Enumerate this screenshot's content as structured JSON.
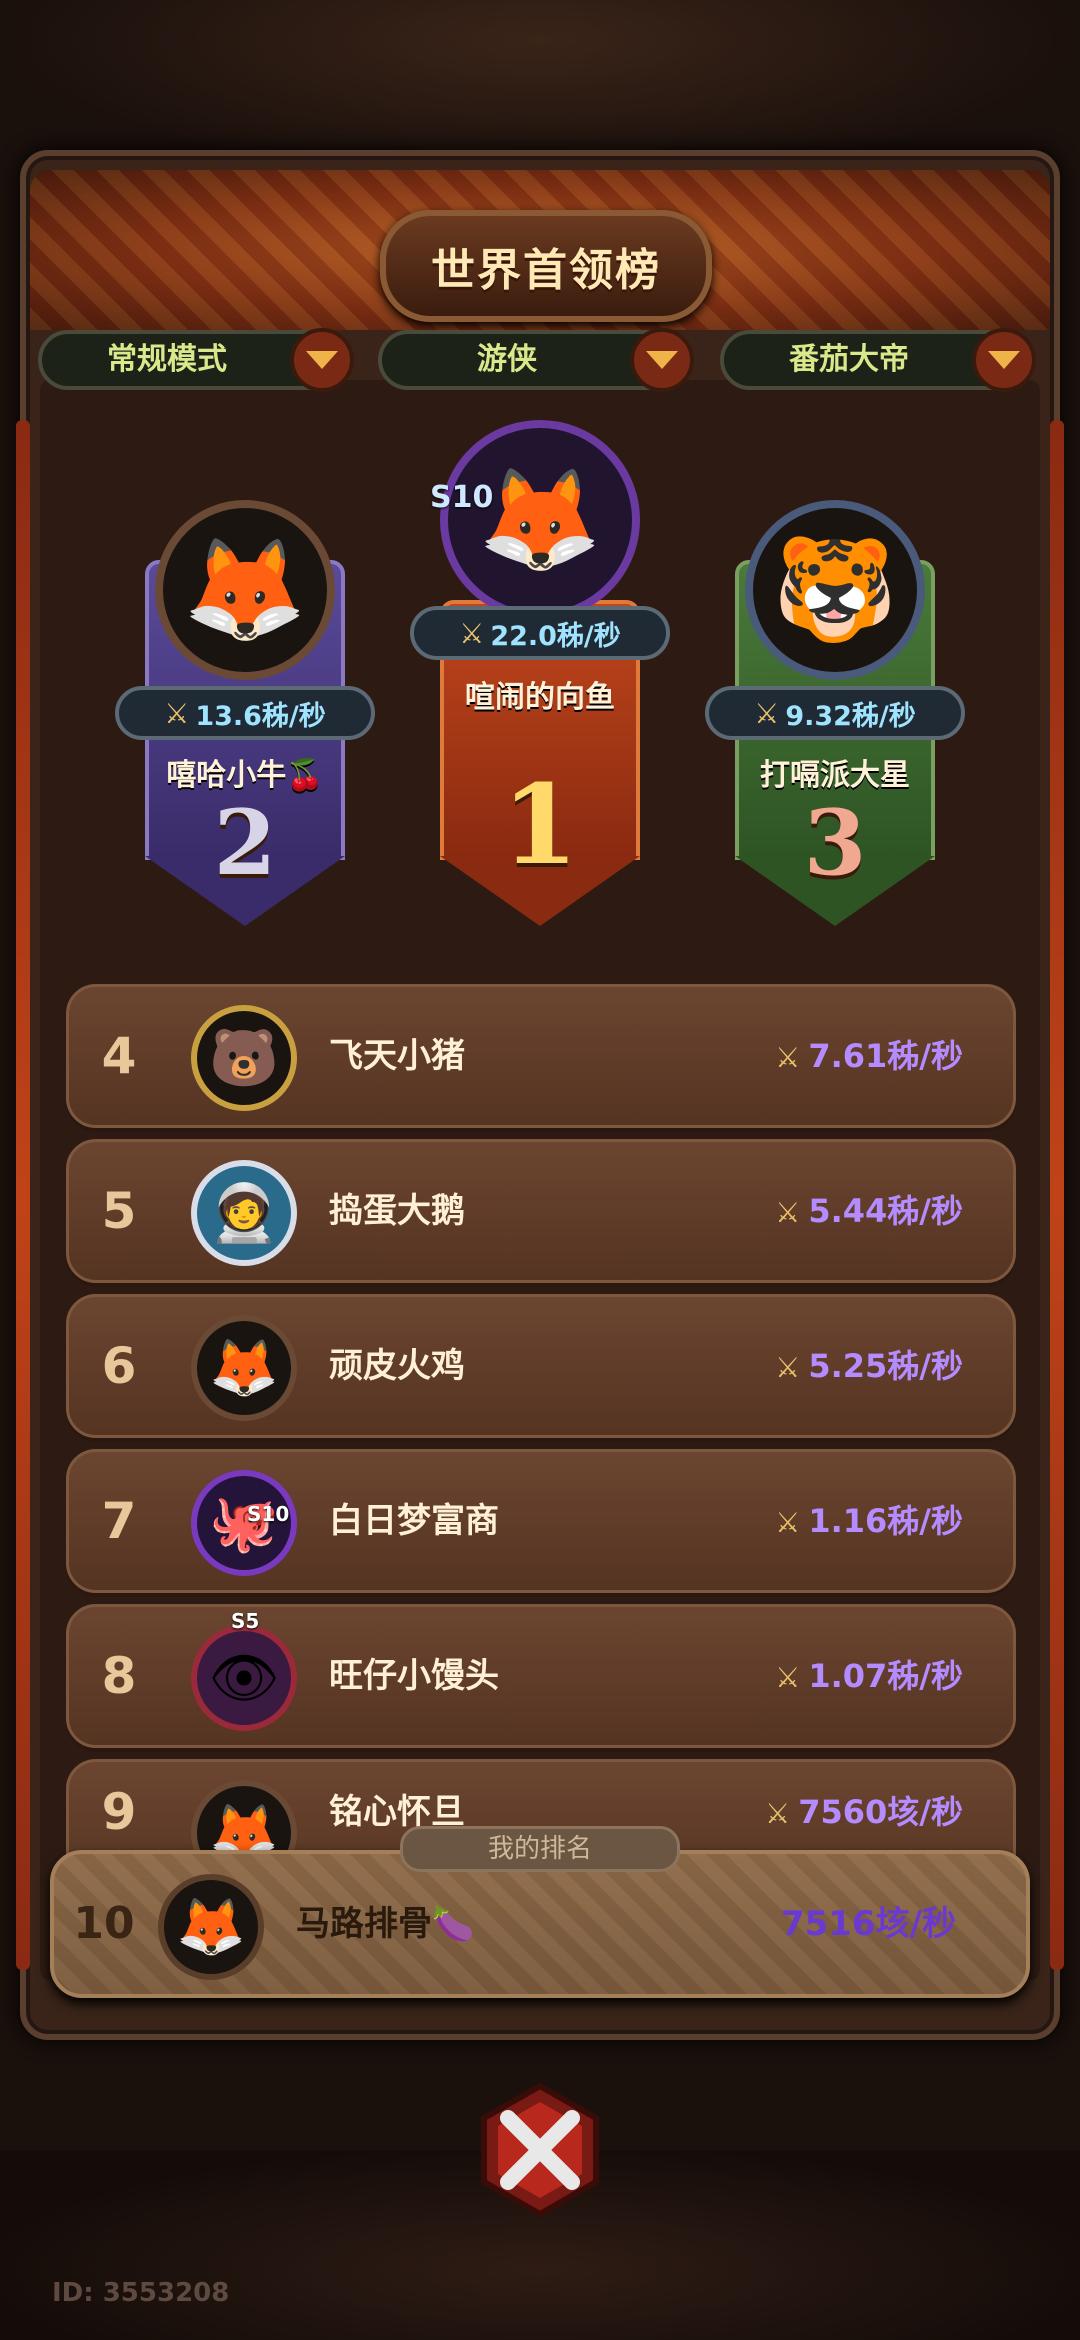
{
  "title": "世界首领榜",
  "filters": [
    {
      "label": "常规模式"
    },
    {
      "label": "游侠"
    },
    {
      "label": "番茄大帝"
    }
  ],
  "podium": [
    {
      "rank": "2",
      "name": "嘻哈小牛🍒",
      "score": "13.6秭/秒"
    },
    {
      "rank": "1",
      "name": "喧闹的向鱼",
      "score": "22.0秭/秒",
      "season": "S10"
    },
    {
      "rank": "3",
      "name": "打嗝派大星",
      "score": "9.32秭/秒"
    }
  ],
  "rows": [
    {
      "rank": "4",
      "name": "飞天小猪",
      "score": "7.61秭/秒"
    },
    {
      "rank": "5",
      "name": "捣蛋大鹅",
      "score": "5.44秭/秒"
    },
    {
      "rank": "6",
      "name": "顽皮火鸡",
      "score": "5.25秭/秒"
    },
    {
      "rank": "7",
      "name": "白日梦富商",
      "score": "1.16秭/秒",
      "season": "S10"
    },
    {
      "rank": "8",
      "name": "旺仔小馒头",
      "score": "1.07秭/秒",
      "season": "S5"
    },
    {
      "rank": "9",
      "name": "铭心怀旦",
      "score": "7560垓/秒"
    }
  ],
  "my_rank": {
    "tag": "我的排名",
    "rank": "10",
    "name": "马路排骨🍆",
    "score": "7516垓/秒"
  },
  "user_id": "ID: 3553208",
  "colors": {
    "score_purple": "#b58cff",
    "podium_score": "#9fe3ff",
    "accent_gold": "#f0b34a"
  }
}
